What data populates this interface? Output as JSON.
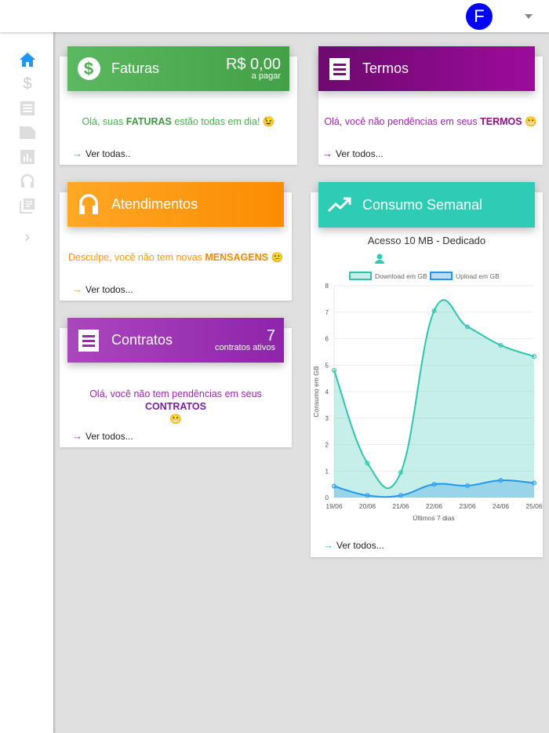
{
  "header": {
    "avatar_letter": "F"
  },
  "sidebar": {
    "items": [
      "home",
      "faturas",
      "termos",
      "contratos",
      "consumo",
      "atendimentos",
      "documentos"
    ],
    "expand": "expand"
  },
  "cards": {
    "faturas": {
      "title": "Faturas",
      "amount": "R$ 0,00",
      "amount_label": "a pagar",
      "msg_pre": "Olá, suas ",
      "msg_bold": "FATURAS",
      "msg_post": " estão todas em dia! 😉",
      "link": "Ver todas..",
      "color": "#4caf50"
    },
    "termos": {
      "title": "Termos",
      "msg_pre": "Olá, você não pendências em seus ",
      "msg_bold": "TERMOS",
      "msg_post": " 😬",
      "link": "Ver todos...",
      "color": "#8e0e8e"
    },
    "atendimentos": {
      "title": "Atendimentos",
      "msg_pre": "Desculpe, você não tem novas ",
      "msg_bold": "MENSAGENS",
      "msg_post": " 😕",
      "link": "Ver todos...",
      "color": "#ff9800"
    },
    "contratos": {
      "title": "Contratos",
      "count": "7",
      "count_label": "contratos ativos",
      "msg_pre": "Olá, você não tem pendências em seus ",
      "msg_bold": "CONTRATOS",
      "msg_post": " 😬",
      "link": "Ver todos...",
      "color": "#9c27b0"
    },
    "consumo": {
      "title": "Consumo Semanal",
      "subtitle": "Acesso 10 MB - Dedicado",
      "link": "Ver todos...",
      "color": "#2ecbb5"
    }
  },
  "chart_data": {
    "type": "line",
    "categories": [
      "19/06",
      "20/06",
      "21/06",
      "22/06",
      "23/06",
      "24/06",
      "25/06"
    ],
    "series": [
      {
        "name": "Download em GB",
        "values": [
          4.8,
          1.3,
          0.95,
          7.05,
          6.45,
          5.75,
          5.33
        ],
        "color": "#2ec4b0",
        "fill": "rgba(46,196,176,0.27)"
      },
      {
        "name": "Upload em GB",
        "values": [
          0.43,
          0.08,
          0.08,
          0.5,
          0.45,
          0.65,
          0.55
        ],
        "color": "#2196f3",
        "fill": "rgba(100,180,230,0.45)"
      }
    ],
    "xlabel": "Últimos 7 dias",
    "ylabel": "Consumo em GB",
    "ylim": [
      0,
      8
    ],
    "yticks": [
      "0",
      "1",
      "2",
      "3",
      "4",
      "5",
      "6",
      "7",
      "8"
    ],
    "grid": true,
    "legend": "top"
  }
}
